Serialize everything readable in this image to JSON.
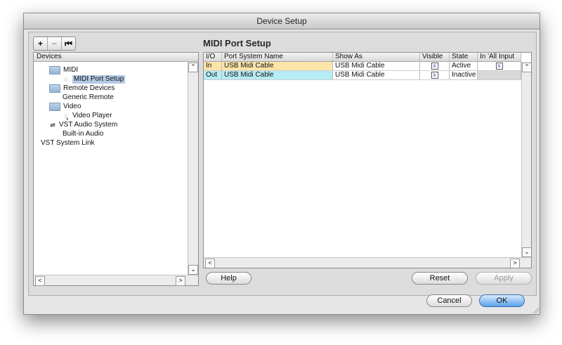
{
  "window": {
    "title": "Device Setup"
  },
  "toolbar": {
    "add_label": "+",
    "remove_label": "−",
    "reset_label": "⏮"
  },
  "devices": {
    "header": "Devices",
    "items": [
      {
        "label": "MIDI",
        "icon": "folder-icon"
      },
      {
        "label": "MIDI Port Setup",
        "icon": "midi-port-icon",
        "selected": true
      },
      {
        "label": "Remote Devices",
        "icon": "folder-icon"
      },
      {
        "label": "Generic Remote",
        "icon": ""
      },
      {
        "label": "Video",
        "icon": "folder-icon"
      },
      {
        "label": "Video Player",
        "icon": "video-player-icon"
      },
      {
        "label": "VST Audio System",
        "icon": "audio-system-icon"
      },
      {
        "label": "Built-in Audio",
        "icon": ""
      },
      {
        "label": "VST System Link",
        "icon": ""
      }
    ]
  },
  "port_setup": {
    "title": "MIDI Port Setup",
    "columns": [
      "I/O",
      "Port System Name",
      "Show As",
      "Visible",
      "State",
      "In 'All Input"
    ],
    "rows": [
      {
        "io": "In",
        "system_name": "USB Midi Cable",
        "show_as": "USB Midi Cable",
        "visible": "x",
        "state": "Active",
        "in_all_inputs": "x"
      },
      {
        "io": "Out",
        "system_name": "USB Midi Cable",
        "show_as": "USB Midi Cable",
        "visible": "x",
        "state": "Inactive",
        "in_all_inputs": ""
      }
    ]
  },
  "buttons": {
    "help": "Help",
    "reset": "Reset",
    "apply": "Apply",
    "cancel": "Cancel",
    "ok": "OK"
  },
  "scroll": {
    "up": "⌃",
    "down": "⌄",
    "left": "<",
    "right": ">"
  },
  "colors": {
    "in_row": "#fde5aa",
    "out_row": "#b6ecf5",
    "primary_button": "#5aa0ea"
  }
}
